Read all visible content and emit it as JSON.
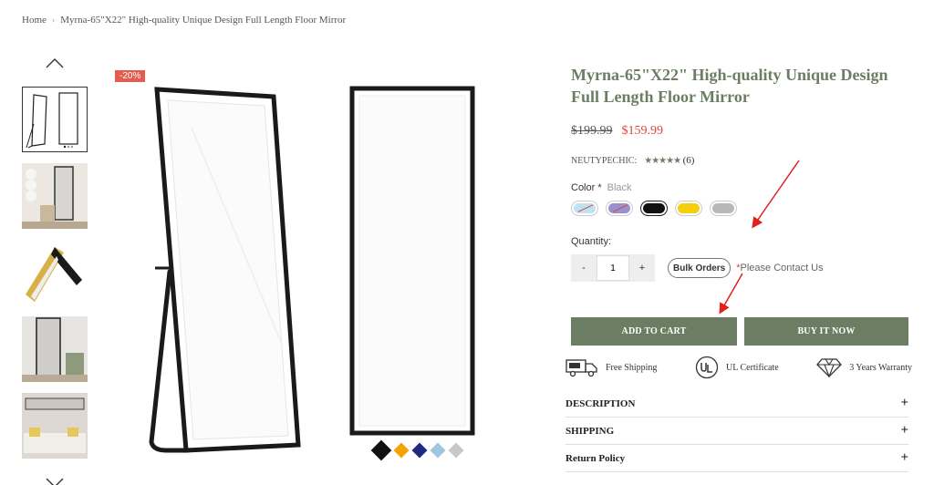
{
  "breadcrumb": {
    "home": "Home",
    "current": "Myrna-65\"X22\" High-quality Unique Design Full Length Floor Mirror"
  },
  "badge": {
    "discount": "-20%"
  },
  "product": {
    "title": "Myrna-65\"X22\" High-quality Unique Design Full Length Floor Mirror",
    "old_price": "$199.99",
    "new_price": "$159.99",
    "vendor": "NEUTYPECHIC:",
    "stars": "★★★★★",
    "review_count": "(6)"
  },
  "color": {
    "label": "Color *",
    "selected": "Black",
    "options": [
      {
        "name": "light-blue",
        "hex": "#bfe3f2",
        "unavailable": true
      },
      {
        "name": "purple",
        "hex": "#9a8fd1",
        "unavailable": true
      },
      {
        "name": "black",
        "hex": "#111111",
        "unavailable": false
      },
      {
        "name": "yellow",
        "hex": "#f5cf0a",
        "unavailable": false
      },
      {
        "name": "gray",
        "hex": "#b8b8b8",
        "unavailable": false
      }
    ]
  },
  "quantity": {
    "label": "Quantity:",
    "minus": "-",
    "value": "1",
    "plus": "+",
    "bulk_label": "Bulk Orders",
    "contact_asterisk": "*",
    "contact_text": "Please Contact Us"
  },
  "actions": {
    "add_to_cart": "ADD TO CART",
    "buy_now": "BUY IT NOW"
  },
  "features": {
    "shipping": "Free Shipping",
    "ul": "UL Certificate",
    "warranty": "3 Years Warranty"
  },
  "accordion": {
    "description": "DESCRIPTION",
    "shipping": "SHIPPING",
    "return_policy": "Return Policy",
    "toggle": "+"
  },
  "gallery_dots": [
    "#111111",
    "#f5a300",
    "#1f2a80",
    "#9fc5e0",
    "#c8c8c8"
  ],
  "colors": {
    "accent": "#6b7e63",
    "sale": "#e0453a",
    "annotation": "#e0201b"
  }
}
